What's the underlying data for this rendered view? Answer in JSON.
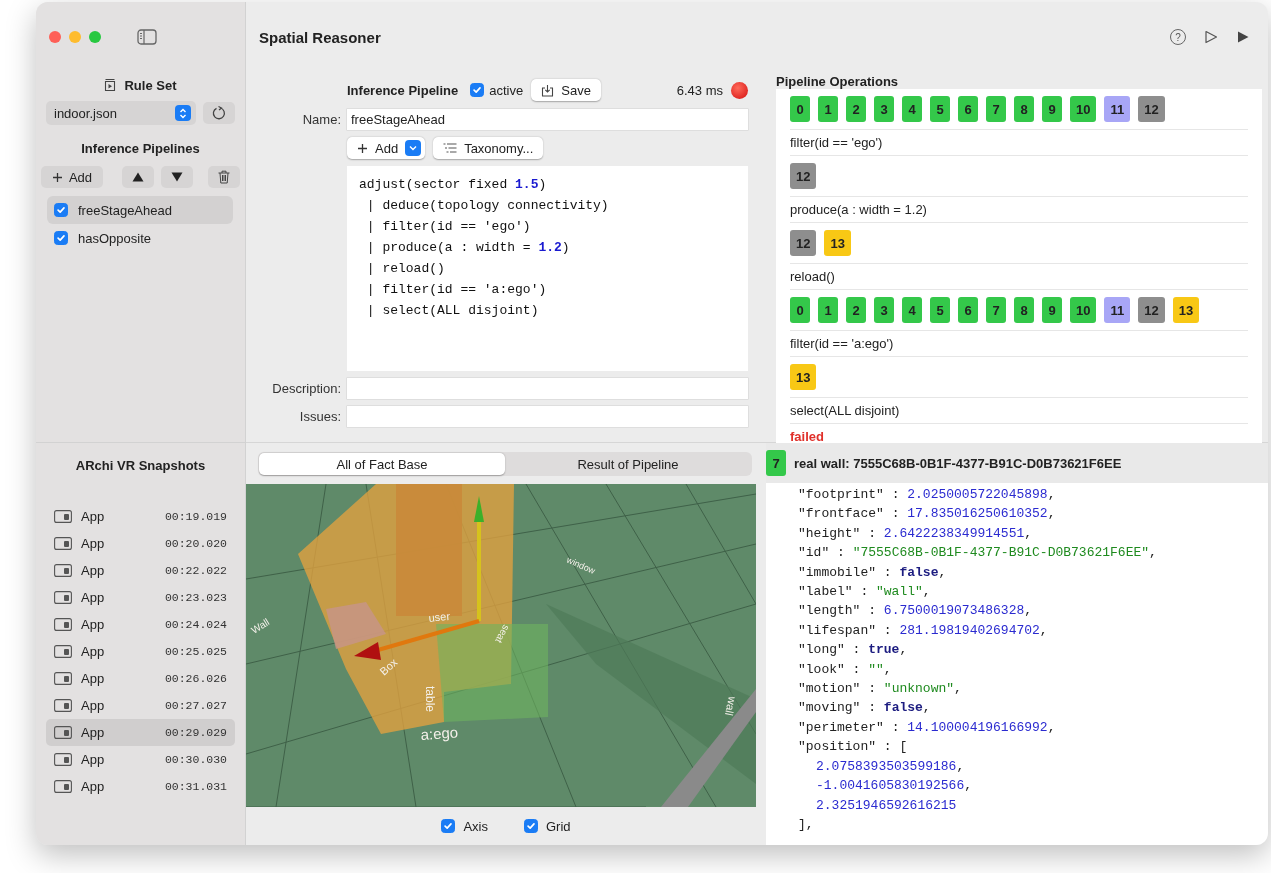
{
  "window": {
    "title": "Spatial Reasoner",
    "help_glyph": "?"
  },
  "sidebar": {
    "rule_set": {
      "title": "Rule Set",
      "file": "indoor.json"
    },
    "pipelines": {
      "title": "Inference Pipelines",
      "add_label": "Add",
      "items": [
        {
          "name": "freeStageAhead",
          "checked": true,
          "selected": true
        },
        {
          "name": "hasOpposite",
          "checked": true,
          "selected": false
        }
      ]
    },
    "snapshots": {
      "title": "ARchi VR Snapshots",
      "items": [
        {
          "name": "App",
          "time": "00:19.019",
          "selected": false
        },
        {
          "name": "App",
          "time": "00:20.020",
          "selected": false
        },
        {
          "name": "App",
          "time": "00:22.022",
          "selected": false
        },
        {
          "name": "App",
          "time": "00:23.023",
          "selected": false
        },
        {
          "name": "App",
          "time": "00:24.024",
          "selected": false
        },
        {
          "name": "App",
          "time": "00:25.025",
          "selected": false
        },
        {
          "name": "App",
          "time": "00:26.026",
          "selected": false
        },
        {
          "name": "App",
          "time": "00:27.027",
          "selected": false
        },
        {
          "name": "App",
          "time": "00:29.029",
          "selected": true
        },
        {
          "name": "App",
          "time": "00:30.030",
          "selected": false
        },
        {
          "name": "App",
          "time": "00:31.031",
          "selected": false
        }
      ]
    }
  },
  "editor": {
    "title": "Inference Pipeline",
    "active": {
      "label": "active",
      "checked": true
    },
    "save_label": "Save",
    "timing": "6.43 ms",
    "error": true,
    "name_label": "Name:",
    "name_value": "freeStageAhead",
    "add_label": "Add",
    "taxonomy_label": "Taxonomy...",
    "code": [
      "adjust(sector fixed **1.5**)",
      " | deduce(topology connectivity)",
      " | filter(id == 'ego')",
      " | produce(a : width = **1.2**)",
      " | reload()",
      " | filter(id == 'a:ego')",
      " | select(ALL disjoint)"
    ],
    "description_label": "Description:",
    "issues_label": "Issues:"
  },
  "operations": {
    "title": "Pipeline Operations",
    "rows": [
      {
        "kind": "ids",
        "chips": [
          {
            "label": "0",
            "color": "#34c84a"
          },
          {
            "label": "1",
            "color": "#34c84a"
          },
          {
            "label": "2",
            "color": "#34c84a"
          },
          {
            "label": "3",
            "color": "#34c84a"
          },
          {
            "label": "4",
            "color": "#34c84a"
          },
          {
            "label": "5",
            "color": "#34c84a"
          },
          {
            "label": "6",
            "color": "#34c84a"
          },
          {
            "label": "7",
            "color": "#34c84a"
          },
          {
            "label": "8",
            "color": "#34c84a"
          },
          {
            "label": "9",
            "color": "#34c84a"
          },
          {
            "label": "10",
            "color": "#34c84a"
          },
          {
            "label": "11",
            "color": "#a8a6f6"
          },
          {
            "label": "12",
            "color": "#8e8e8e"
          }
        ]
      },
      {
        "kind": "op",
        "text": "filter(id == 'ego')"
      },
      {
        "kind": "ids",
        "chips": [
          {
            "label": "12",
            "color": "#8e8e8e"
          }
        ]
      },
      {
        "kind": "op",
        "text": "produce(a : width = 1.2)"
      },
      {
        "kind": "ids",
        "chips": [
          {
            "label": "12",
            "color": "#8e8e8e"
          },
          {
            "label": "13",
            "color": "#f8c815"
          }
        ]
      },
      {
        "kind": "op",
        "text": "reload()"
      },
      {
        "kind": "ids",
        "chips": [
          {
            "label": "0",
            "color": "#34c84a"
          },
          {
            "label": "1",
            "color": "#34c84a"
          },
          {
            "label": "2",
            "color": "#34c84a"
          },
          {
            "label": "3",
            "color": "#34c84a"
          },
          {
            "label": "4",
            "color": "#34c84a"
          },
          {
            "label": "5",
            "color": "#34c84a"
          },
          {
            "label": "6",
            "color": "#34c84a"
          },
          {
            "label": "7",
            "color": "#34c84a"
          },
          {
            "label": "8",
            "color": "#34c84a"
          },
          {
            "label": "9",
            "color": "#34c84a"
          },
          {
            "label": "10",
            "color": "#34c84a"
          },
          {
            "label": "11",
            "color": "#a8a6f6"
          },
          {
            "label": "12",
            "color": "#8e8e8e"
          },
          {
            "label": "13",
            "color": "#f8c815"
          }
        ]
      },
      {
        "kind": "op",
        "text": "filter(id == 'a:ego')"
      },
      {
        "kind": "ids",
        "chips": [
          {
            "label": "13",
            "color": "#f8c815"
          }
        ]
      },
      {
        "kind": "op",
        "text": "select(ALL disjoint)"
      },
      {
        "kind": "status",
        "text": "failed"
      }
    ]
  },
  "view_tabs": [
    {
      "label": "All of Fact Base",
      "selected": true
    },
    {
      "label": "Result of Pipeline",
      "selected": false
    }
  ],
  "scene": {
    "labels": [
      "Wall",
      "window",
      "user",
      "seat",
      "Box",
      "table",
      "a:ego",
      "wall"
    ]
  },
  "scene_options": [
    {
      "label": "Axis",
      "checked": true
    },
    {
      "label": "Grid",
      "checked": true
    }
  ],
  "inspector": {
    "badge": {
      "label": "7",
      "color": "#34c84a"
    },
    "title": "real wall: 7555C68B-0B1F-4377-B91C-D0B73621F6EE",
    "lines": [
      {
        "key": "\"footprint\"",
        "sep": " : ",
        "value": "2.0250005722045898",
        "kind": "number",
        "punct": ","
      },
      {
        "key": "\"frontface\"",
        "sep": " : ",
        "value": "17.835016250610352",
        "kind": "number",
        "punct": ","
      },
      {
        "key": "\"height\"",
        "sep": " : ",
        "value": "2.6422238349914551",
        "kind": "number",
        "punct": ","
      },
      {
        "key": "\"id\"",
        "sep": " : ",
        "value": "\"7555C68B-0B1F-4377-B91C-D0B73621F6EE\"",
        "kind": "string",
        "punct": ","
      },
      {
        "key": "\"immobile\"",
        "sep": " : ",
        "value": "false",
        "kind": "bool",
        "punct": ","
      },
      {
        "key": "\"label\"",
        "sep": " : ",
        "value": "\"wall\"",
        "kind": "string",
        "punct": ","
      },
      {
        "key": "\"length\"",
        "sep": " : ",
        "value": "6.7500019073486328",
        "kind": "number",
        "punct": ","
      },
      {
        "key": "\"lifespan\"",
        "sep": " : ",
        "value": "281.19819402694702",
        "kind": "number",
        "punct": ","
      },
      {
        "key": "\"long\"",
        "sep": " : ",
        "value": "true",
        "kind": "bool",
        "punct": ","
      },
      {
        "key": "\"look\"",
        "sep": " : ",
        "value": "\"\"",
        "kind": "string",
        "punct": ","
      },
      {
        "key": "\"motion\"",
        "sep": " : ",
        "value": "\"unknown\"",
        "kind": "string",
        "punct": ","
      },
      {
        "key": "\"moving\"",
        "sep": " : ",
        "value": "false",
        "kind": "bool",
        "punct": ","
      },
      {
        "key": "\"perimeter\"",
        "sep": " : ",
        "value": "14.100004196166992",
        "kind": "number",
        "punct": ","
      },
      {
        "key": "\"position\"",
        "sep": " : ",
        "value": "[",
        "kind": "bracket",
        "children": [
          {
            "value": "2.0758393503599186",
            "kind": "number",
            "punct": ","
          },
          {
            "value": "-1.0041605830192566",
            "kind": "number",
            "punct": ","
          },
          {
            "value": "2.3251946592616215",
            "kind": "number"
          }
        ]
      },
      {
        "value": "],",
        "kind": "bracket"
      }
    ]
  }
}
